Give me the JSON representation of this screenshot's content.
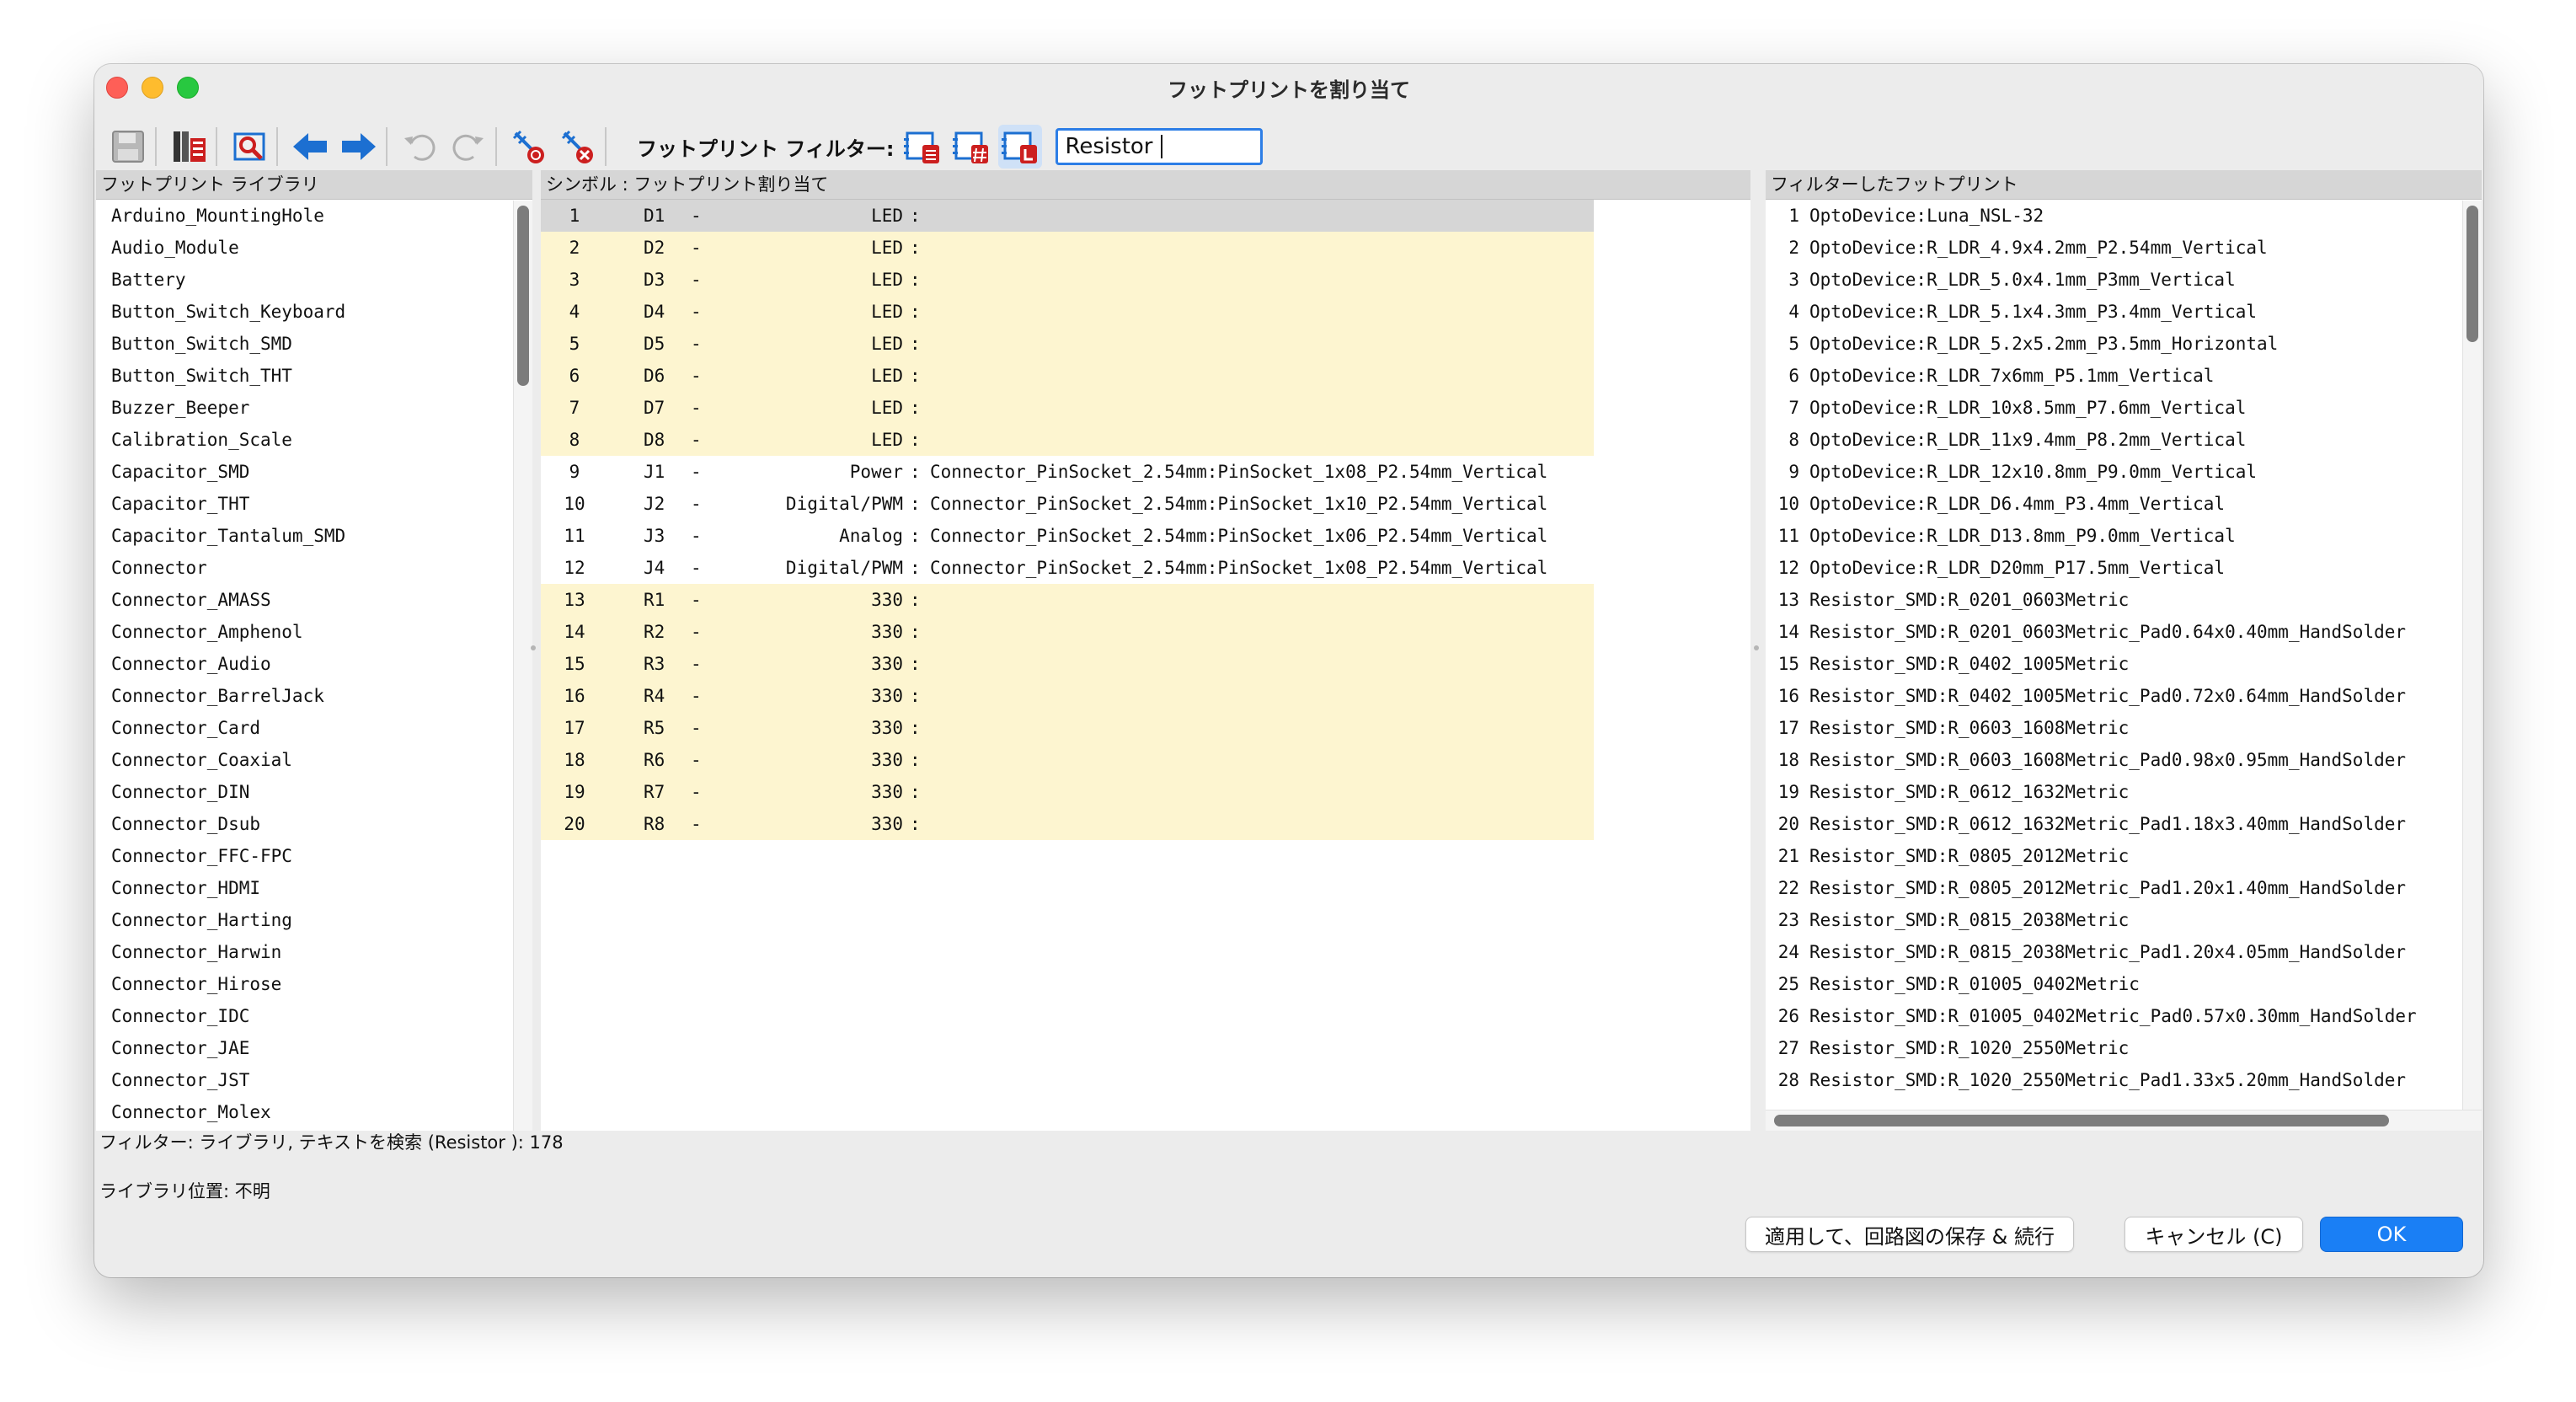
{
  "window": {
    "title": "フットプリントを割り当て"
  },
  "toolbar": {
    "filter_label": "フットプリント フィルター:",
    "search_value": "Resistor",
    "icons": [
      "save-icon",
      "library-browser-icon",
      "footprint-viewer-icon",
      "previous-arrow-icon",
      "next-arrow-icon",
      "undo-icon",
      "redo-icon",
      "auto-associate-icon",
      "delete-associations-icon",
      "filter-by-keywords-icon",
      "filter-by-pin-count-icon",
      "filter-by-library-icon"
    ]
  },
  "libraries": {
    "header": "フットプリント ライブラリ",
    "items": [
      "Arduino_MountingHole",
      "Audio_Module",
      "Battery",
      "Button_Switch_Keyboard",
      "Button_Switch_SMD",
      "Button_Switch_THT",
      "Buzzer_Beeper",
      "Calibration_Scale",
      "Capacitor_SMD",
      "Capacitor_THT",
      "Capacitor_Tantalum_SMD",
      "Connector",
      "Connector_AMASS",
      "Connector_Amphenol",
      "Connector_Audio",
      "Connector_BarrelJack",
      "Connector_Card",
      "Connector_Coaxial",
      "Connector_DIN",
      "Connector_Dsub",
      "Connector_FFC-FPC",
      "Connector_HDMI",
      "Connector_Harting",
      "Connector_Harwin",
      "Connector_Hirose",
      "Connector_IDC",
      "Connector_JAE",
      "Connector_JST",
      "Connector_Molex"
    ]
  },
  "symbols": {
    "header": "シンボル : フットプリント割り当て",
    "rows": [
      {
        "idx": "1",
        "ref": "D1",
        "dash": "-",
        "value": "LED",
        "colon": ":",
        "footprint": "",
        "state": "selected"
      },
      {
        "idx": "2",
        "ref": "D2",
        "dash": "-",
        "value": "LED",
        "colon": ":",
        "footprint": "",
        "state": "unassigned"
      },
      {
        "idx": "3",
        "ref": "D3",
        "dash": "-",
        "value": "LED",
        "colon": ":",
        "footprint": "",
        "state": "unassigned"
      },
      {
        "idx": "4",
        "ref": "D4",
        "dash": "-",
        "value": "LED",
        "colon": ":",
        "footprint": "",
        "state": "unassigned"
      },
      {
        "idx": "5",
        "ref": "D5",
        "dash": "-",
        "value": "LED",
        "colon": ":",
        "footprint": "",
        "state": "unassigned"
      },
      {
        "idx": "6",
        "ref": "D6",
        "dash": "-",
        "value": "LED",
        "colon": ":",
        "footprint": "",
        "state": "unassigned"
      },
      {
        "idx": "7",
        "ref": "D7",
        "dash": "-",
        "value": "LED",
        "colon": ":",
        "footprint": "",
        "state": "unassigned"
      },
      {
        "idx": "8",
        "ref": "D8",
        "dash": "-",
        "value": "LED",
        "colon": ":",
        "footprint": "",
        "state": "unassigned"
      },
      {
        "idx": "9",
        "ref": "J1",
        "dash": "-",
        "value": "Power",
        "colon": ":",
        "footprint": "Connector_PinSocket_2.54mm:PinSocket_1x08_P2.54mm_Vertical",
        "state": "assigned"
      },
      {
        "idx": "10",
        "ref": "J2",
        "dash": "-",
        "value": "Digital/PWM",
        "colon": ":",
        "footprint": "Connector_PinSocket_2.54mm:PinSocket_1x10_P2.54mm_Vertical",
        "state": "assigned"
      },
      {
        "idx": "11",
        "ref": "J3",
        "dash": "-",
        "value": "Analog",
        "colon": ":",
        "footprint": "Connector_PinSocket_2.54mm:PinSocket_1x06_P2.54mm_Vertical",
        "state": "assigned"
      },
      {
        "idx": "12",
        "ref": "J4",
        "dash": "-",
        "value": "Digital/PWM",
        "colon": ":",
        "footprint": "Connector_PinSocket_2.54mm:PinSocket_1x08_P2.54mm_Vertical",
        "state": "assigned"
      },
      {
        "idx": "13",
        "ref": "R1",
        "dash": "-",
        "value": "330",
        "colon": ":",
        "footprint": "",
        "state": "unassigned"
      },
      {
        "idx": "14",
        "ref": "R2",
        "dash": "-",
        "value": "330",
        "colon": ":",
        "footprint": "",
        "state": "unassigned"
      },
      {
        "idx": "15",
        "ref": "R3",
        "dash": "-",
        "value": "330",
        "colon": ":",
        "footprint": "",
        "state": "unassigned"
      },
      {
        "idx": "16",
        "ref": "R4",
        "dash": "-",
        "value": "330",
        "colon": ":",
        "footprint": "",
        "state": "unassigned"
      },
      {
        "idx": "17",
        "ref": "R5",
        "dash": "-",
        "value": "330",
        "colon": ":",
        "footprint": "",
        "state": "unassigned"
      },
      {
        "idx": "18",
        "ref": "R6",
        "dash": "-",
        "value": "330",
        "colon": ":",
        "footprint": "",
        "state": "unassigned"
      },
      {
        "idx": "19",
        "ref": "R7",
        "dash": "-",
        "value": "330",
        "colon": ":",
        "footprint": "",
        "state": "unassigned"
      },
      {
        "idx": "20",
        "ref": "R8",
        "dash": "-",
        "value": "330",
        "colon": ":",
        "footprint": "",
        "state": "unassigned"
      }
    ]
  },
  "footprints": {
    "header": "フィルターしたフットプリント",
    "items": [
      {
        "idx": "1",
        "name": "OptoDevice:Luna_NSL-32"
      },
      {
        "idx": "2",
        "name": "OptoDevice:R_LDR_4.9x4.2mm_P2.54mm_Vertical"
      },
      {
        "idx": "3",
        "name": "OptoDevice:R_LDR_5.0x4.1mm_P3mm_Vertical"
      },
      {
        "idx": "4",
        "name": "OptoDevice:R_LDR_5.1x4.3mm_P3.4mm_Vertical"
      },
      {
        "idx": "5",
        "name": "OptoDevice:R_LDR_5.2x5.2mm_P3.5mm_Horizontal"
      },
      {
        "idx": "6",
        "name": "OptoDevice:R_LDR_7x6mm_P5.1mm_Vertical"
      },
      {
        "idx": "7",
        "name": "OptoDevice:R_LDR_10x8.5mm_P7.6mm_Vertical"
      },
      {
        "idx": "8",
        "name": "OptoDevice:R_LDR_11x9.4mm_P8.2mm_Vertical"
      },
      {
        "idx": "9",
        "name": "OptoDevice:R_LDR_12x10.8mm_P9.0mm_Vertical"
      },
      {
        "idx": "10",
        "name": "OptoDevice:R_LDR_D6.4mm_P3.4mm_Vertical"
      },
      {
        "idx": "11",
        "name": "OptoDevice:R_LDR_D13.8mm_P9.0mm_Vertical"
      },
      {
        "idx": "12",
        "name": "OptoDevice:R_LDR_D20mm_P17.5mm_Vertical"
      },
      {
        "idx": "13",
        "name": "Resistor_SMD:R_0201_0603Metric"
      },
      {
        "idx": "14",
        "name": "Resistor_SMD:R_0201_0603Metric_Pad0.64x0.40mm_HandSolder"
      },
      {
        "idx": "15",
        "name": "Resistor_SMD:R_0402_1005Metric"
      },
      {
        "idx": "16",
        "name": "Resistor_SMD:R_0402_1005Metric_Pad0.72x0.64mm_HandSolder"
      },
      {
        "idx": "17",
        "name": "Resistor_SMD:R_0603_1608Metric"
      },
      {
        "idx": "18",
        "name": "Resistor_SMD:R_0603_1608Metric_Pad0.98x0.95mm_HandSolder"
      },
      {
        "idx": "19",
        "name": "Resistor_SMD:R_0612_1632Metric"
      },
      {
        "idx": "20",
        "name": "Resistor_SMD:R_0612_1632Metric_Pad1.18x3.40mm_HandSolder"
      },
      {
        "idx": "21",
        "name": "Resistor_SMD:R_0805_2012Metric"
      },
      {
        "idx": "22",
        "name": "Resistor_SMD:R_0805_2012Metric_Pad1.20x1.40mm_HandSolder"
      },
      {
        "idx": "23",
        "name": "Resistor_SMD:R_0815_2038Metric"
      },
      {
        "idx": "24",
        "name": "Resistor_SMD:R_0815_2038Metric_Pad1.20x4.05mm_HandSolder"
      },
      {
        "idx": "25",
        "name": "Resistor_SMD:R_01005_0402Metric"
      },
      {
        "idx": "26",
        "name": "Resistor_SMD:R_01005_0402Metric_Pad0.57x0.30mm_HandSolder"
      },
      {
        "idx": "27",
        "name": "Resistor_SMD:R_1020_2550Metric"
      },
      {
        "idx": "28",
        "name": "Resistor_SMD:R_1020_2550Metric_Pad1.33x5.20mm_HandSolder"
      }
    ]
  },
  "status": {
    "filter_text": "フィルター: ライブラリ, テキストを検索 (Resistor  ): 178",
    "library_location": "ライブラリ位置: 不明"
  },
  "buttons": {
    "apply_save": "適用して、回路図の保存 & 続行",
    "cancel": "キャンセル (C)",
    "ok": "OK"
  },
  "colors": {
    "accent": "#1a7ff5",
    "unassigned_row": "#fdf5d0",
    "selected_row": "#d6d6d6",
    "arrow_blue": "#1c6fd1",
    "icon_red": "#cc1f1f"
  }
}
